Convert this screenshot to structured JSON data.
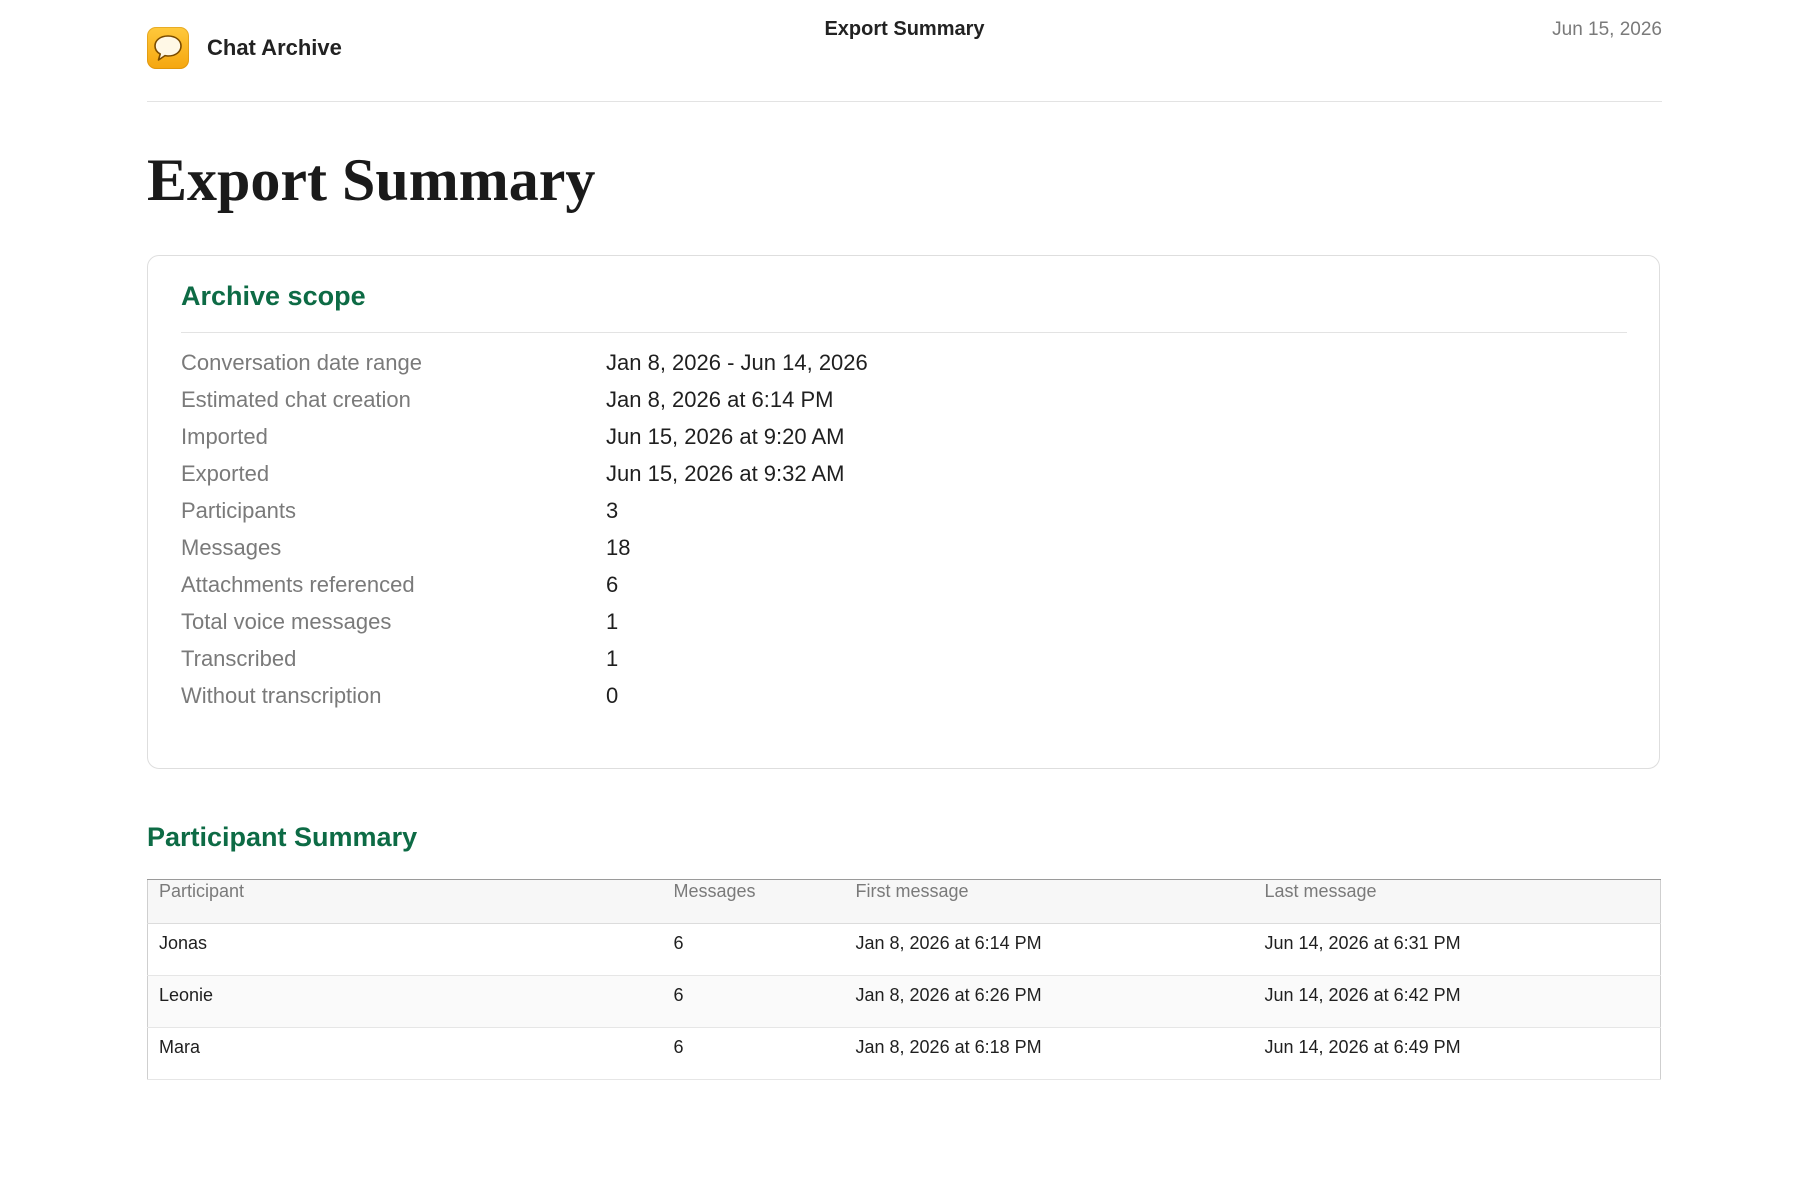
{
  "header": {
    "app_name": "Chat Archive",
    "title": "Export Summary",
    "date": "Jun 15, 2026",
    "icon": "chat-bubble-icon",
    "icon_color": "#f5a60f"
  },
  "page_title": "Export Summary",
  "scope": {
    "heading": "Archive scope",
    "rows": [
      {
        "label": "Conversation date range",
        "value": "Jan 8, 2026 - Jun 14, 2026"
      },
      {
        "label": "Estimated chat creation",
        "value": "Jan 8, 2026 at 6:14 PM"
      },
      {
        "label": "Imported",
        "value": "Jun 15, 2026 at 9:20 AM"
      },
      {
        "label": "Exported",
        "value": "Jun 15, 2026 at 9:32 AM"
      },
      {
        "label": "Participants",
        "value": "3"
      },
      {
        "label": "Messages",
        "value": "18"
      },
      {
        "label": "Attachments referenced",
        "value": "6"
      },
      {
        "label": "Total voice messages",
        "value": "1"
      },
      {
        "label": "Transcribed",
        "value": "1"
      },
      {
        "label": "Without transcription",
        "value": "0"
      }
    ]
  },
  "participants": {
    "heading": "Participant Summary",
    "columns": [
      "Participant",
      "Messages",
      "First message",
      "Last message"
    ],
    "rows": [
      {
        "name": "Jonas",
        "messages": "6",
        "first": "Jan 8, 2026 at 6:14 PM",
        "last": "Jun 14, 2026 at 6:31 PM"
      },
      {
        "name": "Leonie",
        "messages": "6",
        "first": "Jan 8, 2026 at 6:26 PM",
        "last": "Jun 14, 2026 at 6:42 PM"
      },
      {
        "name": "Mara",
        "messages": "6",
        "first": "Jan 8, 2026 at 6:18 PM",
        "last": "Jun 14, 2026 at 6:49 PM"
      }
    ]
  },
  "colors": {
    "accent": "#0d6b45",
    "muted_text": "#7a7a7a"
  }
}
